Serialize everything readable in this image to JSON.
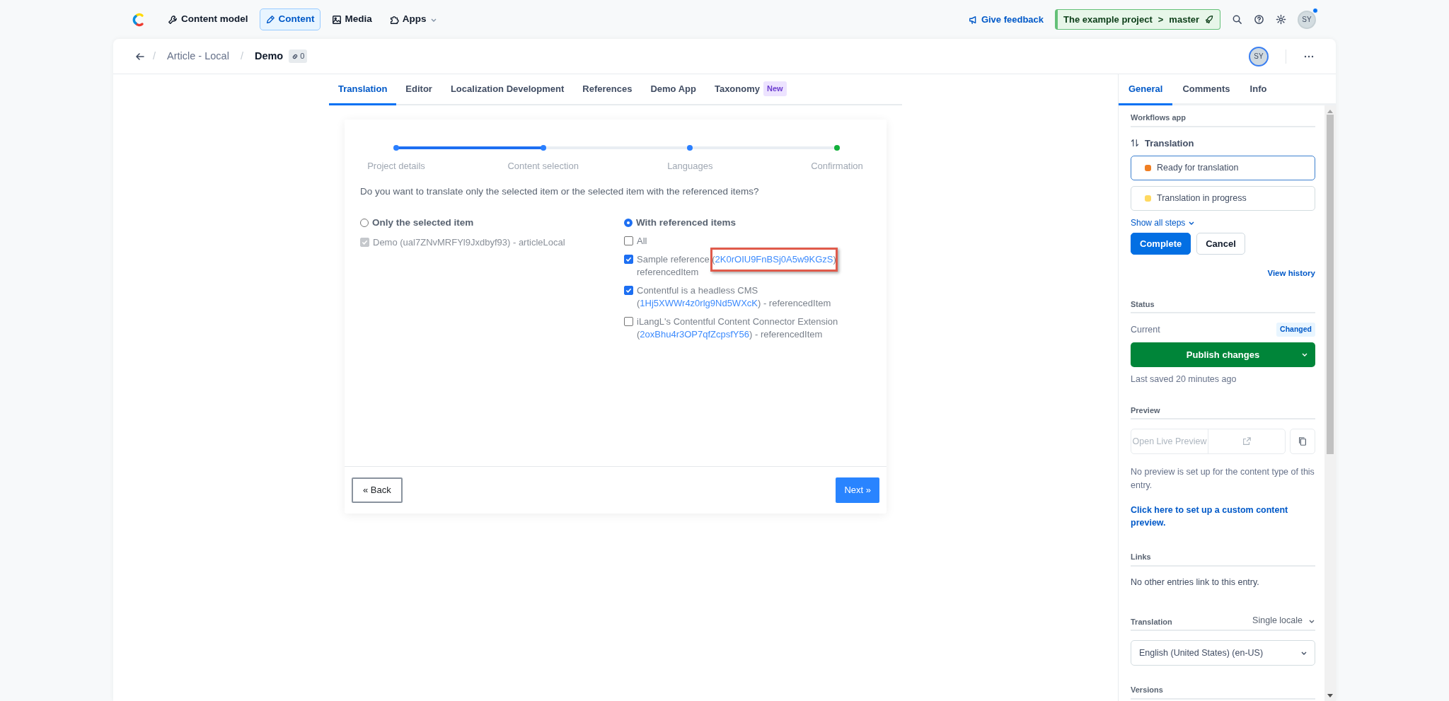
{
  "topbar": {
    "nav": [
      {
        "label": "Content model",
        "selected": false,
        "menu": false
      },
      {
        "label": "Content",
        "selected": true,
        "menu": false
      },
      {
        "label": "Media",
        "selected": false,
        "menu": false
      },
      {
        "label": "Apps",
        "selected": false,
        "menu": true
      }
    ],
    "feedback": "Give feedback",
    "environment": {
      "active": true,
      "project": "The example project",
      "separator": ">",
      "branch": "master"
    },
    "avatar": "SY",
    "notification": true
  },
  "entry_header": {
    "breadcrumb": "Article - Local",
    "separator": "/",
    "title": "Demo",
    "links_count": "0",
    "avatar": "SY"
  },
  "tabs": [
    {
      "label": "Translation",
      "selected": true
    },
    {
      "label": "Editor",
      "selected": false
    },
    {
      "label": "Localization Development",
      "selected": false
    },
    {
      "label": "References",
      "selected": false
    },
    {
      "label": "Demo App",
      "selected": false
    },
    {
      "label": "Taxonomy",
      "badge": "New",
      "selected": false
    }
  ],
  "wizard": {
    "level": 0.333,
    "steps": [
      {
        "label": "Project details",
        "color": "#2a7fff"
      },
      {
        "label": "Content selection",
        "color": "#2a7fff"
      },
      {
        "label": "Languages",
        "color": "#2a7fff"
      },
      {
        "label": "Confirmation",
        "color": "#12b03a"
      }
    ],
    "question": "Do you want to translate only the selected item or the selected item with the referenced items?",
    "options": [
      {
        "label": "Only the selected item",
        "selected": false,
        "items": [
          {
            "before": "Demo (ual7ZNvMRFYl9Jxdbyf93) - articleLocal",
            "checked": true,
            "disabled": true
          }
        ]
      },
      {
        "label": "With referenced items",
        "selected": true,
        "items": [
          {
            "before": "All",
            "checked": false,
            "disabled": false
          },
          {
            "before": "Sample reference (",
            "link": "2K0rOIU9FnBSj0A5w9KGzS",
            "after": ") referencedItem",
            "checked": true,
            "disabled": false,
            "highlighted": true
          },
          {
            "before": "Contentful is a headless CMS (",
            "link": "1Hj5XWWr4z0rlg9Nd5WXcK",
            "after": ") - referencedItem",
            "checked": true,
            "disabled": false
          },
          {
            "before": "iLangL's Contentful Content Connector Extension (",
            "link": "2oxBhu4r3OP7qfZcpsfY56",
            "after": ") - referencedItem",
            "checked": false,
            "disabled": false
          }
        ]
      }
    ],
    "back": "« Back",
    "next": "Next »"
  },
  "sidebar": {
    "tabs": [
      {
        "label": "General",
        "selected": true
      },
      {
        "label": "Comments",
        "selected": false
      },
      {
        "label": "Info",
        "selected": false
      }
    ],
    "workflow": {
      "heading": "Workflows app",
      "name": "Translation",
      "steps": [
        {
          "label": "Ready for translation",
          "color": "#f07f23",
          "selected": true
        },
        {
          "label": "Translation in progress",
          "color": "#ffd960",
          "selected": false
        }
      ],
      "show_all": "Show all steps",
      "actions": [
        {
          "label": "Complete",
          "kind": "primary"
        },
        {
          "label": "Cancel",
          "kind": "secondary"
        }
      ],
      "history": "View history"
    },
    "status": {
      "heading": "Status",
      "label": "Current",
      "badge": "Changed",
      "publish": "Publish changes",
      "saved": "Last saved 20 minutes ago"
    },
    "preview": {
      "heading": "Preview",
      "button": "Open Live Preview",
      "disabled": true,
      "note": "No preview is set up for the content type of this entry.",
      "link": "Click here to set up a custom content preview."
    },
    "links": {
      "heading": "Links",
      "note": "No other entries link to this entry."
    },
    "translation": {
      "heading": "Translation",
      "mode": "Single locale",
      "locale": "English (United States) (en-US)"
    },
    "versions": {
      "heading": "Versions"
    }
  }
}
